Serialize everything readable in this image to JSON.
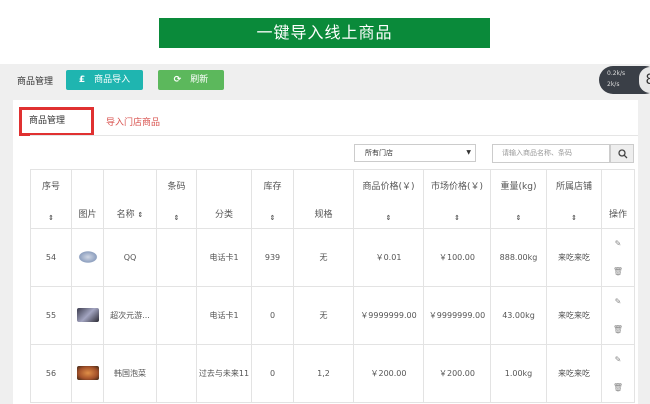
{
  "banner": {
    "title": "一键导入线上商品"
  },
  "toolbar": {
    "crumb": "商品管理",
    "import_label": "商品导入",
    "refresh_label": "刷新"
  },
  "speed": {
    "up": "0.2k/s",
    "down": "2k/s",
    "value": "8"
  },
  "tabs": {
    "active": "商品管理",
    "other": "导入门店商品"
  },
  "filters": {
    "store": "所有门店",
    "search_placeholder": "请输入商品名称、条码"
  },
  "table": {
    "headers": [
      "序号",
      "图片",
      "名称",
      "条码",
      "分类",
      "库存",
      "规格",
      "商品价格(￥)",
      "市场价格(￥)",
      "重量(kg)",
      "所属店铺",
      "操作"
    ],
    "rows": [
      {
        "no": "54",
        "name": "QQ",
        "code": "",
        "category": "电话卡1",
        "stock": "939",
        "spec": "无",
        "price": "￥0.01",
        "market": "￥100.00",
        "weight": "888.00kg",
        "store": "来吃来吃"
      },
      {
        "no": "55",
        "name": "超次元游...",
        "code": "",
        "category": "电话卡1",
        "stock": "0",
        "spec": "无",
        "price": "￥9999999.00",
        "market": "￥9999999.00",
        "weight": "43.00kg",
        "store": "来吃来吃"
      },
      {
        "no": "56",
        "name": "韩国泡菜",
        "code": "",
        "category": "过去与未来11",
        "stock": "0",
        "spec": "1,2",
        "price": "￥200.00",
        "market": "￥200.00",
        "weight": "1.00kg",
        "store": "来吃来吃"
      }
    ]
  },
  "colors": {
    "banner": "#0a8a3a",
    "import_btn": "#1fb5b0",
    "refresh_btn": "#5cb85c",
    "highlight": "#e03131"
  }
}
